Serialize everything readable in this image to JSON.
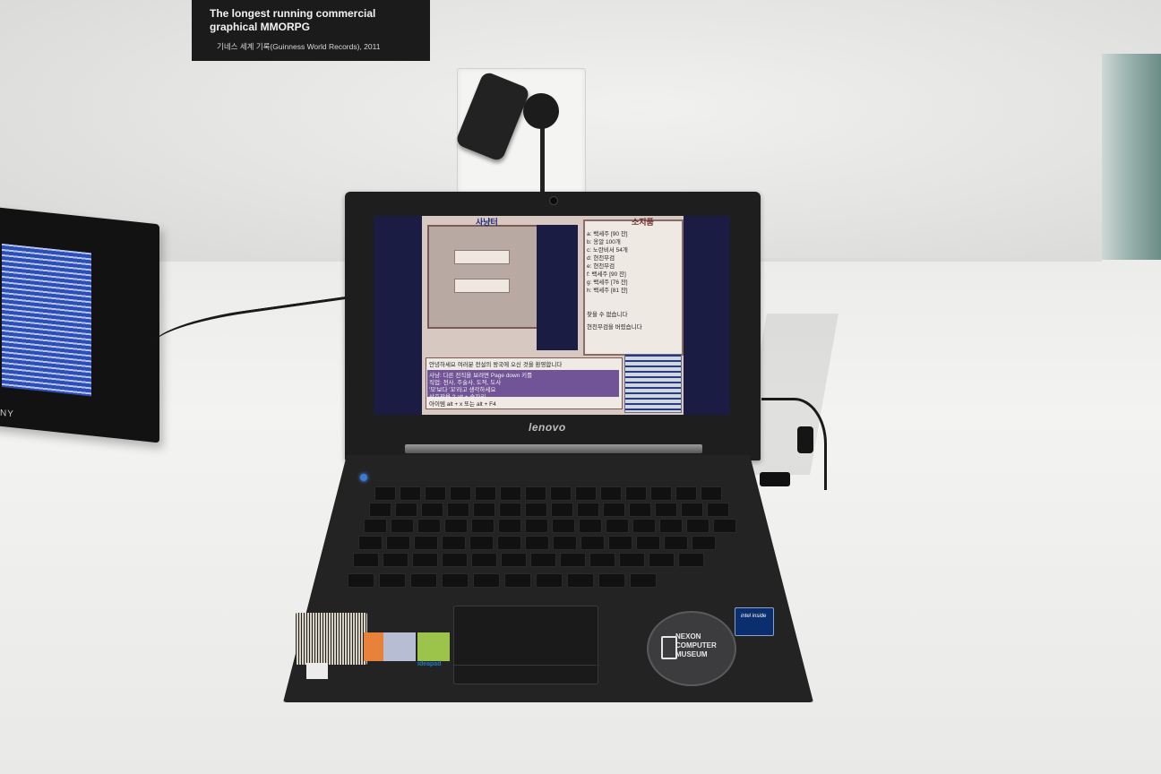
{
  "placard": {
    "title": "The longest running commercial graphical MMORPG",
    "subtitle": "기네스 세계 기록(Guinness World Records), 2011"
  },
  "laptop": {
    "brand": "lenovo",
    "screen_title_left": "사냥터",
    "screen_title_right": "소지품",
    "inventory": [
      "a: 백세주 [90 잔]",
      "b: 옹알 100개",
      "c: 노란비서 54개",
      "d: 현천무검",
      "e: 현천무검",
      "f: 백세주 [90 잔]",
      "g: 백세주 [76 잔]",
      "h: 백세주 [81 잔]"
    ],
    "inventory_msgs": [
      "찾을 수 없습니다",
      "현천무검을 버렸습니다"
    ],
    "chat": [
      "안녕하세요 여러분 전설의 왕국에 오신 것을 환영합니다",
      "사냥: 다른 전직을 보려면 Page down 키를",
      "직업: 전사, 주술사, 도적, 도사",
      "'모'보다 '꼬'라고 생각하세요",
      "상호작용 ? alt + 숫자키",
      "아이템 alt + x 또는 alt + F4"
    ],
    "sticker": "NEXON COMPUTER MUSEUM",
    "intel_badge": "intel inside",
    "idea_label": "ideapad"
  },
  "monitor": {
    "brand": "NY"
  },
  "colors": {
    "laptop_body": "#232324",
    "screen_blue": "#1a1c44",
    "placard": "#1b1b1b"
  }
}
